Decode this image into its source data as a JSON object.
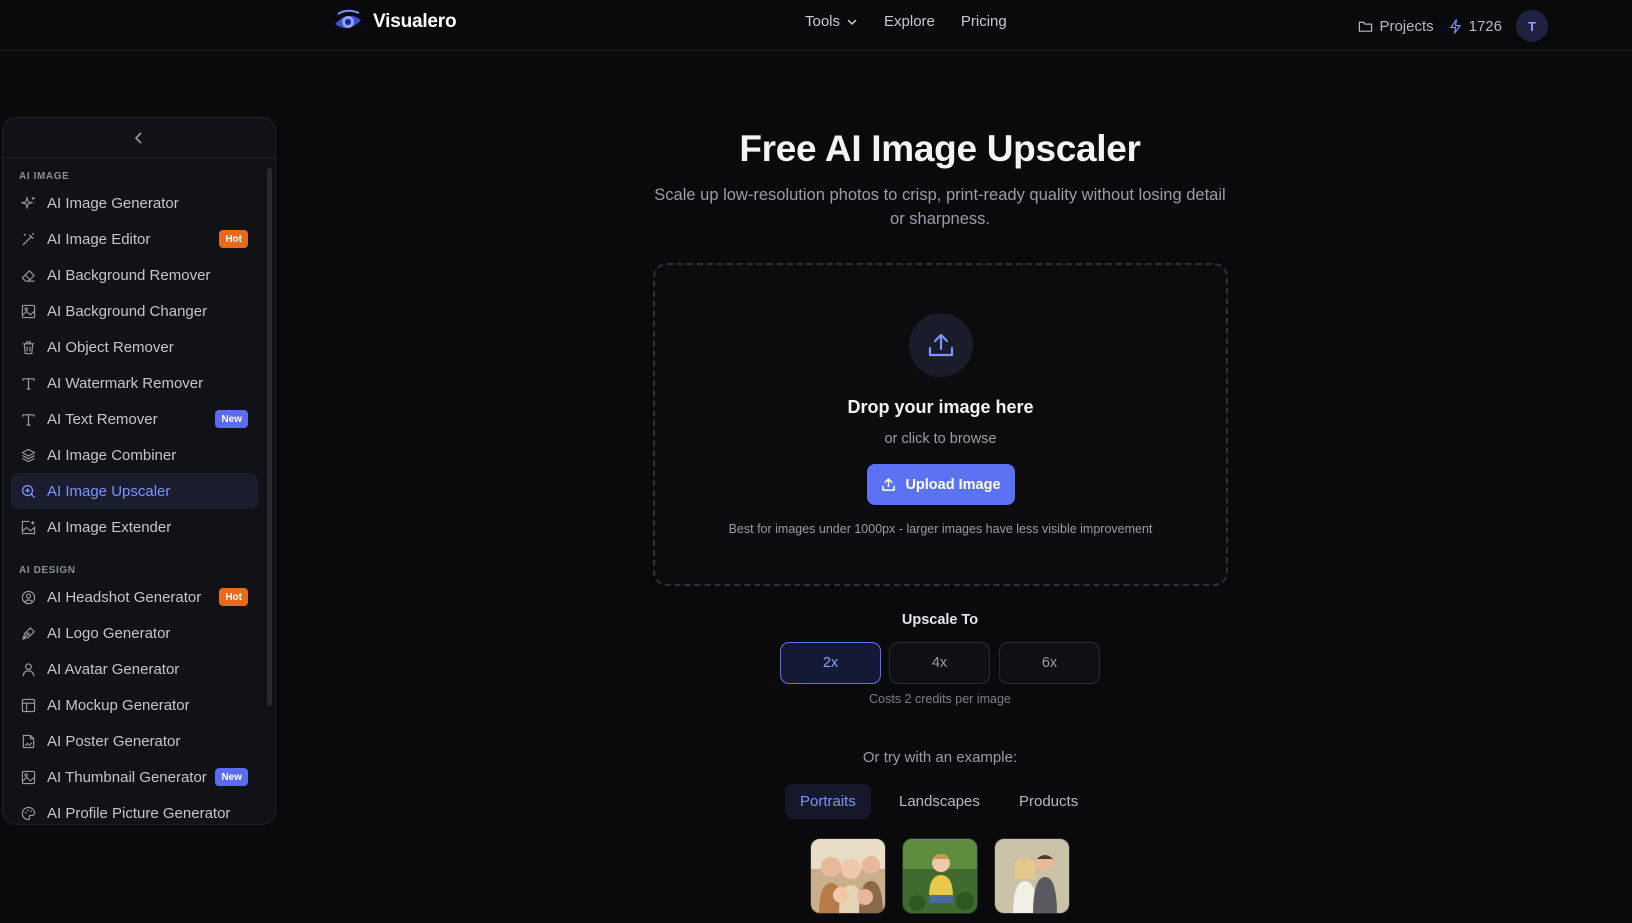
{
  "header": {
    "brand": "Visualero",
    "nav": [
      {
        "label": "Tools",
        "icon": "chevron-down-icon"
      },
      {
        "label": "Explore"
      },
      {
        "label": "Pricing"
      }
    ],
    "projects_label": "Projects",
    "credits": "1726",
    "avatar_initial": "T"
  },
  "sidebar": {
    "sections": [
      {
        "title": "AI IMAGE",
        "items": [
          {
            "label": "AI Image Generator",
            "icon": "sparkles-icon"
          },
          {
            "label": "AI Image Editor",
            "icon": "magic-wand-icon",
            "badge": "Hot"
          },
          {
            "label": "AI Background Remover",
            "icon": "eraser-icon"
          },
          {
            "label": "AI Background Changer",
            "icon": "image-icon"
          },
          {
            "label": "AI Object Remover",
            "icon": "trash-icon"
          },
          {
            "label": "AI Watermark Remover",
            "icon": "text-icon"
          },
          {
            "label": "AI Text Remover",
            "icon": "text-icon",
            "badge": "New"
          },
          {
            "label": "AI Image Combiner",
            "icon": "layers-icon"
          },
          {
            "label": "AI Image Upscaler",
            "icon": "zoom-in-icon",
            "active": true
          },
          {
            "label": "AI Image Extender",
            "icon": "image-plus-icon"
          }
        ]
      },
      {
        "title": "AI DESIGN",
        "items": [
          {
            "label": "AI Headshot Generator",
            "icon": "user-circle-icon",
            "badge": "Hot"
          },
          {
            "label": "AI Logo Generator",
            "icon": "pen-tool-icon"
          },
          {
            "label": "AI Avatar Generator",
            "icon": "user-icon"
          },
          {
            "label": "AI Mockup Generator",
            "icon": "layout-icon"
          },
          {
            "label": "AI Poster Generator",
            "icon": "file-image-icon"
          },
          {
            "label": "AI Thumbnail Generator",
            "icon": "image-icon",
            "badge": "New"
          },
          {
            "label": "AI Profile Picture Generator",
            "icon": "palette-icon"
          }
        ]
      }
    ]
  },
  "main": {
    "title": "Free AI Image Upscaler",
    "subtitle": "Scale up low-resolution photos to crisp, print-ready quality without losing detail or sharpness.",
    "dropzone": {
      "title": "Drop your image here",
      "subtitle": "or click to browse",
      "button": "Upload Image",
      "hint": "Best for images under 1000px - larger images have less visible improvement"
    },
    "upscale": {
      "label": "Upscale To",
      "options": [
        "2x",
        "4x",
        "6x"
      ],
      "selected": "2x",
      "cost_note": "Costs 2 credits per image"
    },
    "examples": {
      "label": "Or try with an example:",
      "tabs": [
        "Portraits",
        "Landscapes",
        "Products"
      ],
      "selected": "Portraits"
    }
  },
  "colors": {
    "accent": "#5b72f5",
    "hot_badge": "#ea6a1c",
    "new_badge": "#5b6cf0",
    "background": "#0a0a0c"
  }
}
